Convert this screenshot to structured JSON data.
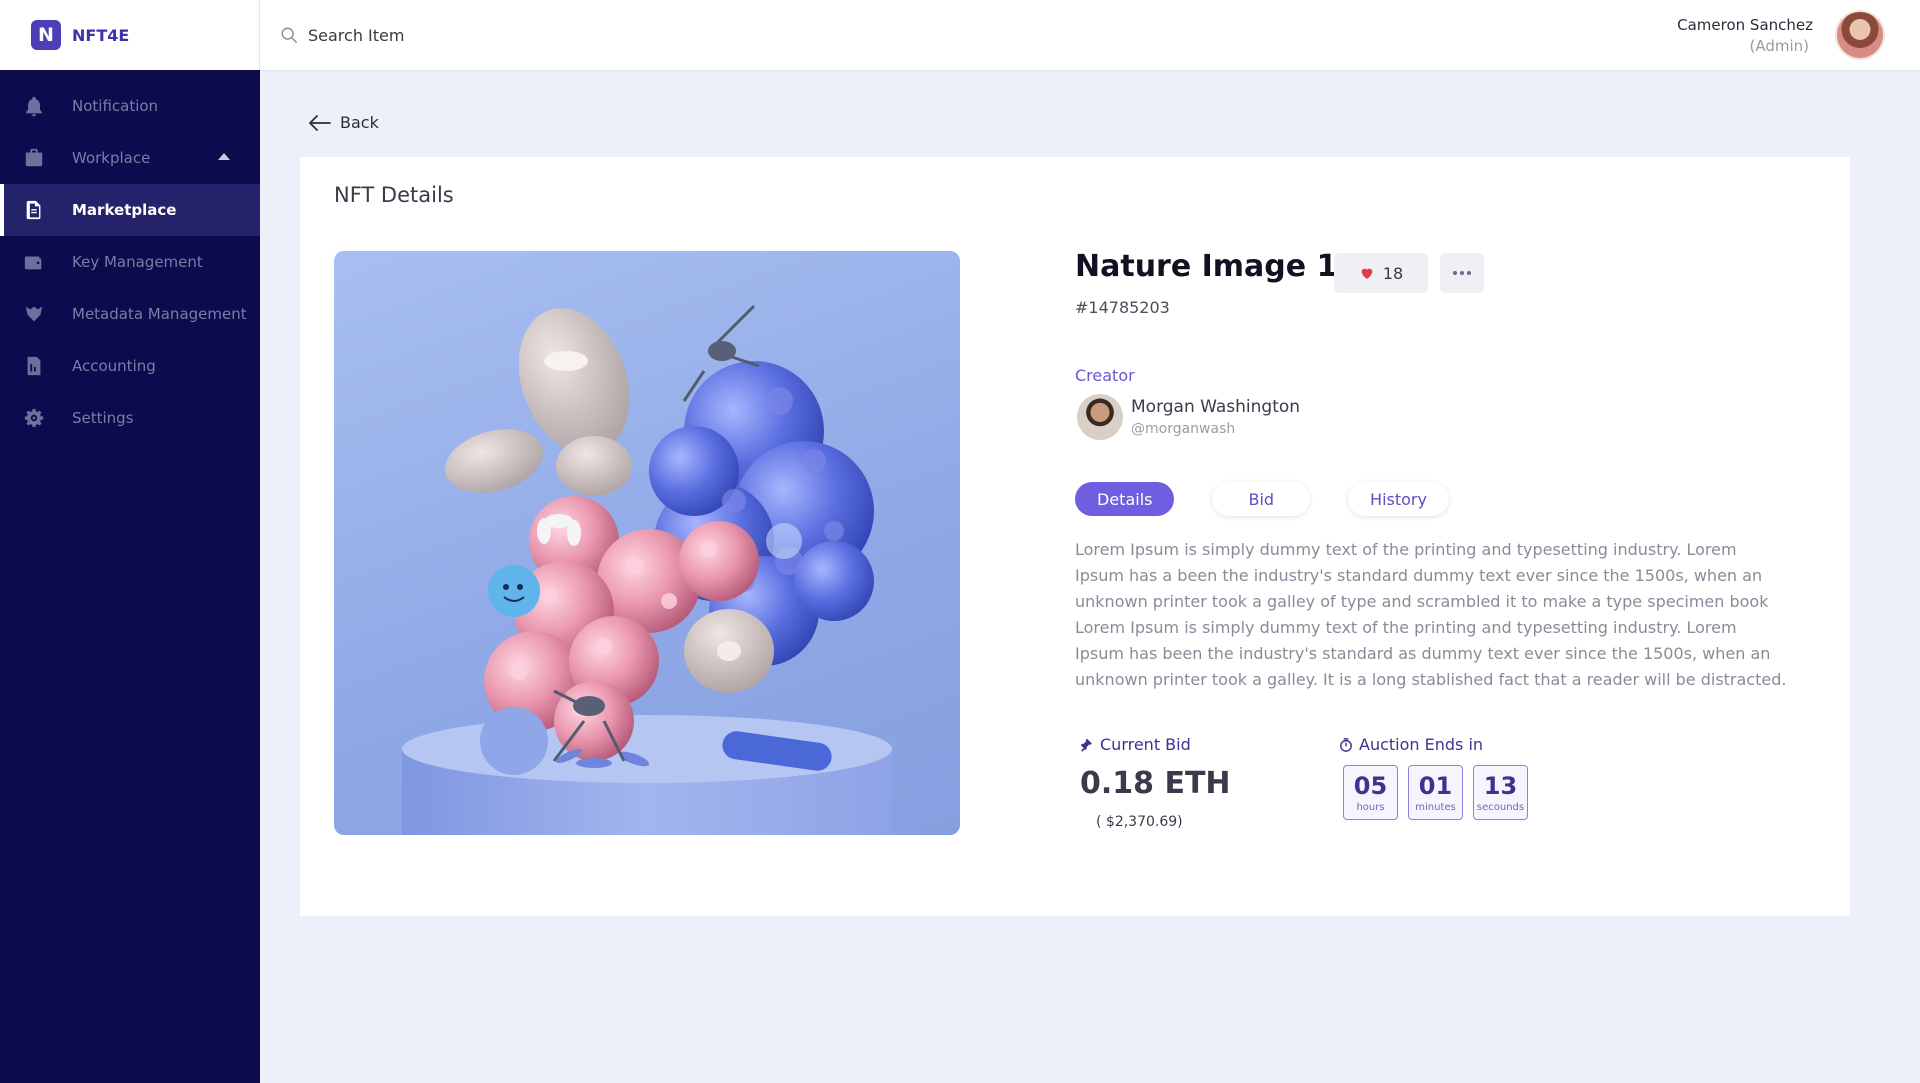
{
  "brand": {
    "logo_letter": "N",
    "name": "NFT4E"
  },
  "sidebar": {
    "items": [
      {
        "label": "Notification",
        "icon": "bell-icon"
      },
      {
        "label": "Workplace",
        "icon": "briefcase-icon"
      },
      {
        "label": "Marketplace",
        "icon": "document-icon",
        "active": true
      },
      {
        "label": "Key Management",
        "icon": "wallet-icon"
      },
      {
        "label": "Metadata Management",
        "icon": "metadata-icon"
      },
      {
        "label": "Accounting",
        "icon": "ledger-icon"
      },
      {
        "label": "Settings",
        "icon": "gear-icon"
      }
    ]
  },
  "header": {
    "search_placeholder": "Search Item",
    "user_name": "Cameron Sanchez",
    "user_role": "(Admin)"
  },
  "main": {
    "back_label": "Back",
    "card_title": "NFT Details",
    "nft": {
      "name": "Nature Image 1",
      "id": "#14785203",
      "likes": "18",
      "creator_label": "Creator",
      "creator_name": "Morgan Washington",
      "creator_handle": "@morganwash"
    },
    "tabs": [
      {
        "label": "Details",
        "active": true
      },
      {
        "label": "Bid"
      },
      {
        "label": "History"
      }
    ],
    "description": "Lorem Ipsum is simply dummy text of the printing and typesetting industry. Lorem Ipsum has a been the industry's standard dummy text ever since the 1500s, when an unknown printer took a galley of type and scrambled it to make a type specimen book Lorem Ipsum is simply dummy text of the printing and typesetting industry. Lorem Ipsum has been the industry's standard as dummy text ever since the 1500s, when an unknown printer took a galley. It is a long stablished fact that a reader will be distracted.",
    "bid": {
      "label": "Current Bid",
      "value": "0.18 ETH",
      "usd": "( $2,370.69)"
    },
    "auction": {
      "label": "Auction Ends in",
      "hours": "05",
      "hours_unit": "hours",
      "minutes": "01",
      "minutes_unit": "minutes",
      "seconds": "13",
      "seconds_unit": "secounds"
    }
  },
  "colors": {
    "sidebar_bg": "#0c0b4e",
    "accent": "#6f5ee0",
    "page_bg": "#eef0f9"
  }
}
